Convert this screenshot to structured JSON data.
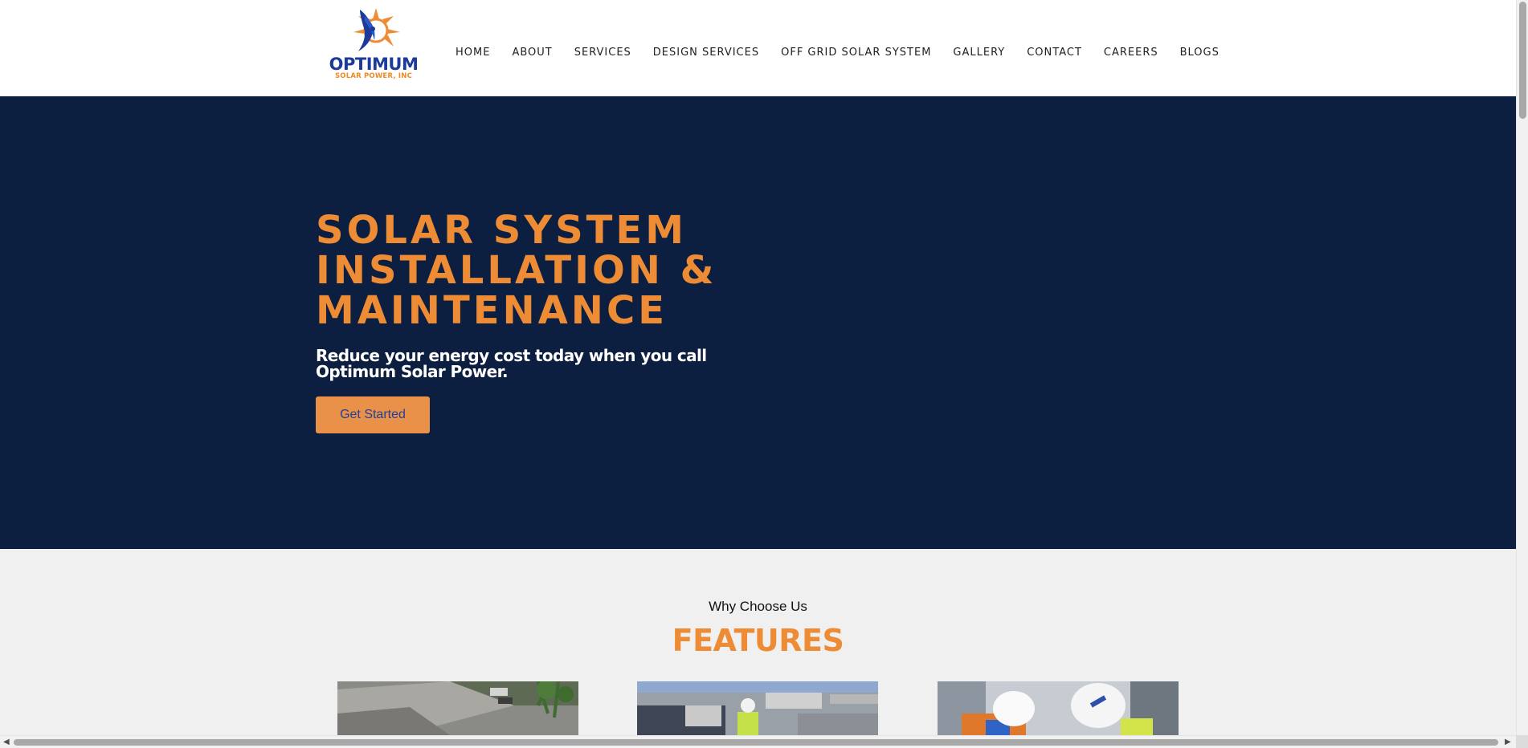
{
  "brand": {
    "name": "OPTIMUM",
    "tagline": "SOLAR POWER, INC",
    "colors": {
      "navy": "#0d1f40",
      "orange": "#ee8c36",
      "blue": "#1b3a9a"
    }
  },
  "nav": {
    "items": [
      {
        "label": "HOME"
      },
      {
        "label": "ABOUT"
      },
      {
        "label": "SERVICES"
      },
      {
        "label": "DESIGN SERVICES"
      },
      {
        "label": "OFF GRID SOLAR SYSTEM"
      },
      {
        "label": "GALLERY"
      },
      {
        "label": "CONTACT"
      },
      {
        "label": "CAREERS"
      },
      {
        "label": "BLOGS"
      }
    ]
  },
  "hero": {
    "title_lines": [
      "SOLAR SYSTEM",
      "INSTALLATION &",
      "MAINTENANCE"
    ],
    "subtitle_lines": [
      "Reduce your energy cost today when you call",
      "Optimum Solar Power."
    ],
    "cta_label": "Get Started"
  },
  "features": {
    "eyebrow": "Why Choose Us",
    "title": "FEATURES",
    "cards": [
      {
        "image": "rooftop-solar-house-photo"
      },
      {
        "image": "technician-on-commercial-roof-photo"
      },
      {
        "image": "workers-in-hard-hats-photo"
      }
    ]
  },
  "icons": {
    "logo": "eagle-sun-icon",
    "scroll_left": "chevron-left-icon",
    "scroll_right": "chevron-right-icon"
  }
}
